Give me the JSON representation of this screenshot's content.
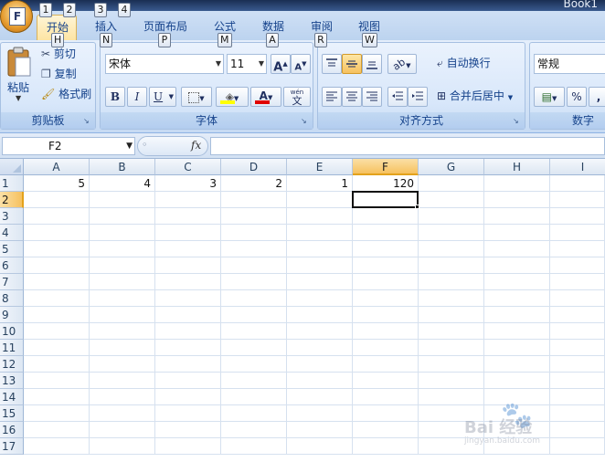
{
  "window": {
    "title": "Book1"
  },
  "quick_access_keytips": [
    "1",
    "2",
    "3",
    "4"
  ],
  "tabs": [
    {
      "label": "开始",
      "keytip": "H",
      "active": true
    },
    {
      "label": "插入",
      "keytip": "N"
    },
    {
      "label": "页面布局",
      "keytip": "P"
    },
    {
      "label": "公式",
      "keytip": "M"
    },
    {
      "label": "数据",
      "keytip": "A"
    },
    {
      "label": "审阅",
      "keytip": "R"
    },
    {
      "label": "视图",
      "keytip": "W"
    }
  ],
  "office_button": {
    "letter": "F"
  },
  "ribbon": {
    "clipboard": {
      "label": "剪贴板",
      "paste": "粘贴",
      "cut": "剪切",
      "copy": "复制",
      "format_painter": "格式刷"
    },
    "font": {
      "label": "字体",
      "font_name": "宋体",
      "font_size": "11",
      "bold": "B",
      "italic": "I",
      "underline": "U",
      "grow": "A",
      "shrink": "A",
      "font_color_letter": "A",
      "phonetic": "文",
      "phonetic_top": "wén"
    },
    "alignment": {
      "label": "对齐方式",
      "wrap_text": "自动换行",
      "merge_center": "合并后居中"
    },
    "number": {
      "label": "数字",
      "format": "常规",
      "percent": "%",
      "comma": ","
    }
  },
  "formula_bar": {
    "name_box": "F2",
    "fx": "fx",
    "content": ""
  },
  "sheet": {
    "columns": [
      "A",
      "B",
      "C",
      "D",
      "E",
      "F",
      "G",
      "H",
      "I"
    ],
    "selected_column": "F",
    "rows": [
      "1",
      "2",
      "3",
      "4",
      "5",
      "6",
      "7",
      "8",
      "9",
      "10",
      "11",
      "12",
      "13",
      "14",
      "15",
      "16",
      "17"
    ],
    "selected_row": "2",
    "active_cell": "F2",
    "cells": [
      {
        "ref": "A1",
        "value": "5"
      },
      {
        "ref": "B1",
        "value": "4"
      },
      {
        "ref": "C1",
        "value": "3"
      },
      {
        "ref": "D1",
        "value": "2"
      },
      {
        "ref": "E1",
        "value": "1"
      },
      {
        "ref": "F1",
        "value": "120"
      }
    ]
  },
  "watermark": {
    "text": "Bai 经验",
    "url": "jingyan.baidu.com"
  }
}
